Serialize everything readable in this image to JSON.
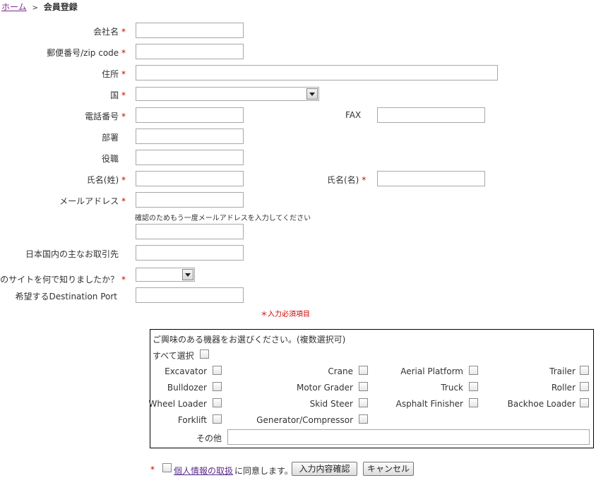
{
  "breadcrumb": {
    "home": "ホーム",
    "separator": ">",
    "current": "会員登録"
  },
  "required_mark": "*",
  "form": {
    "company": {
      "label": "会社名",
      "value": ""
    },
    "zip": {
      "label": "郵便番号/zip code",
      "value": ""
    },
    "address": {
      "label": "住所",
      "value": ""
    },
    "country": {
      "label": "国",
      "selected": ""
    },
    "phone": {
      "label": "電話番号",
      "value": ""
    },
    "fax": {
      "label": "FAX",
      "value": ""
    },
    "department": {
      "label": "部署",
      "value": ""
    },
    "position": {
      "label": "役職",
      "value": ""
    },
    "last_name": {
      "label": "氏名(姓)",
      "value": ""
    },
    "first_name": {
      "label": "氏名(名)",
      "value": ""
    },
    "email": {
      "label": "メールアドレス",
      "value": ""
    },
    "email_confirm": {
      "note": "確認のためもう一度メールアドレスを入力してください",
      "value": ""
    },
    "main_partner": {
      "label": "日本国内の主なお取引先",
      "value": ""
    },
    "how_found": {
      "label": "このサイトを何で知りましたか？",
      "selected": ""
    },
    "destination_port": {
      "label": "希望するDestination Port",
      "value": ""
    },
    "required_note": "＊入力必須項目"
  },
  "equipment": {
    "heading": "ご興味のある機器をお選びください。(複数選択可)",
    "select_all": "すべて選択",
    "items": [
      "Excavator",
      "Crane",
      "Aerial Platform",
      "Trailer",
      "Bulldozer",
      "Motor Grader",
      "Truck",
      "Roller",
      "Wheel Loader",
      "Skid Steer",
      "Asphalt Finisher",
      "Backhoe Loader",
      "Forklift",
      "Generator/Compressor"
    ],
    "other_label": "その他",
    "other_value": ""
  },
  "agreement": {
    "link_text": "個人情報の取扱",
    "suffix": "に同意します。",
    "confirm_button": "入力内容確認",
    "cancel_button": "キャンセル"
  }
}
